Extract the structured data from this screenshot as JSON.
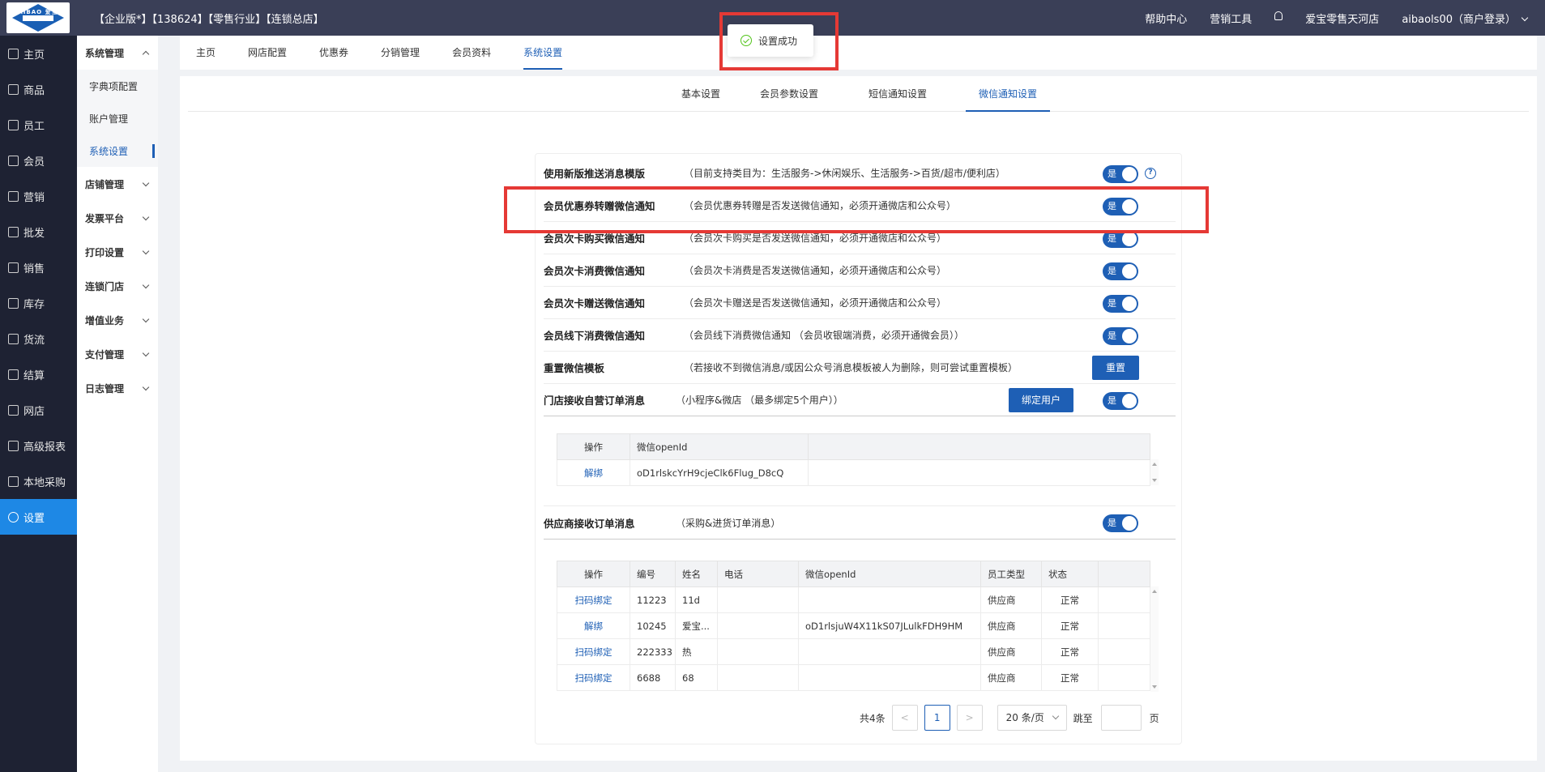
{
  "header": {
    "logo_text": "AIBAO 爱宝",
    "edition": "【企业版*】【138624】【零售行业】【连锁总店】",
    "help": "帮助中心",
    "marketing": "营销工具",
    "store": "爱宝零售天河店",
    "user": "aibaols00（商户登录）"
  },
  "toast": {
    "message": "设置成功"
  },
  "leftnav": [
    {
      "label": "主页"
    },
    {
      "label": "商品"
    },
    {
      "label": "员工"
    },
    {
      "label": "会员"
    },
    {
      "label": "营销"
    },
    {
      "label": "批发"
    },
    {
      "label": "销售"
    },
    {
      "label": "库存"
    },
    {
      "label": "货流"
    },
    {
      "label": "结算"
    },
    {
      "label": "网店"
    },
    {
      "label": "高级报表"
    },
    {
      "label": "本地采购"
    },
    {
      "label": "设置"
    }
  ],
  "subnav": {
    "group_system": "系统管理",
    "items": [
      "字典项配置",
      "账户管理",
      "系统设置"
    ],
    "groups": [
      "店铺管理",
      "发票平台",
      "打印设置",
      "连锁门店",
      "增值业务",
      "支付管理",
      "日志管理"
    ]
  },
  "tabs": [
    "主页",
    "网店配置",
    "优惠券",
    "分销管理",
    "会员资料",
    "系统设置"
  ],
  "subtabs": [
    "基本设置",
    "会员参数设置",
    "短信通知设置",
    "微信通知设置"
  ],
  "settings": [
    {
      "label": "使用新版推送消息模版",
      "desc": "（目前支持类目为：生活服务->休闲娱乐、生活服务->百货/超市/便利店）",
      "toggle": "是"
    },
    {
      "label": "会员优惠券转赠微信通知",
      "desc": "（会员优惠券转赠是否发送微信通知，必须开通微店和公众号）",
      "toggle": "是"
    },
    {
      "label": "会员次卡购买微信通知",
      "desc": "（会员次卡购买是否发送微信通知，必须开通微店和公众号）",
      "toggle": "是"
    },
    {
      "label": "会员次卡消费微信通知",
      "desc": "（会员次卡消费是否发送微信通知，必须开通微店和公众号）",
      "toggle": "是"
    },
    {
      "label": "会员次卡赠送微信通知",
      "desc": "（会员次卡赠送是否发送微信通知，必须开通微店和公众号）",
      "toggle": "是"
    },
    {
      "label": "会员线下消费微信通知",
      "desc": "（会员线下消费微信通知 （会员收银端消费，必须开通微会员））",
      "toggle": "是"
    }
  ],
  "reset": {
    "label": "重置微信模板",
    "desc": "（若接收不到微信消息/或因公众号消息模板被人为删除，则可尝试重置模板）",
    "button": "重置"
  },
  "store_order": {
    "label": "门店接收自营订单消息",
    "desc": "（小程序&微店 （最多绑定5个用户））",
    "button": "绑定用户",
    "toggle": "是"
  },
  "openid_table": {
    "headers": [
      "操作",
      "微信openId"
    ],
    "rows": [
      {
        "op": "解绑",
        "openid": "oD1rlskcYrH9cjeClk6Flug_D8cQ"
      }
    ]
  },
  "supplier": {
    "label": "供应商接收订单消息",
    "desc": "（采购&进货订单消息）",
    "toggle": "是"
  },
  "supplier_table": {
    "headers": [
      "操作",
      "编号",
      "姓名",
      "电话",
      "微信openId",
      "员工类型",
      "状态"
    ],
    "rows": [
      {
        "op": "扫码绑定",
        "id": "11223",
        "name": "11d",
        "phone": "",
        "openid": "",
        "type": "供应商",
        "status": "正常"
      },
      {
        "op": "解绑",
        "id": "10245",
        "name": "爱宝...",
        "phone": "",
        "openid": "oD1rlsjuW4X11kS07JLulkFDH9HM",
        "type": "供应商",
        "status": "正常"
      },
      {
        "op": "扫码绑定",
        "id": "222333",
        "name": "热",
        "phone": "",
        "openid": "",
        "type": "供应商",
        "status": "正常"
      },
      {
        "op": "扫码绑定",
        "id": "6688",
        "name": "68",
        "phone": "",
        "openid": "",
        "type": "供应商",
        "status": "正常"
      }
    ]
  },
  "pager": {
    "total": "共4条",
    "current": "1",
    "size": "20 条/页",
    "jump": "跳至",
    "page_suffix": "页",
    "prev": "<",
    "next": ">"
  },
  "colors": {
    "primary": "#1e5fb5",
    "nav_bg": "#1e2233",
    "header_bg": "#3a3f57",
    "highlight": "#e53935"
  }
}
